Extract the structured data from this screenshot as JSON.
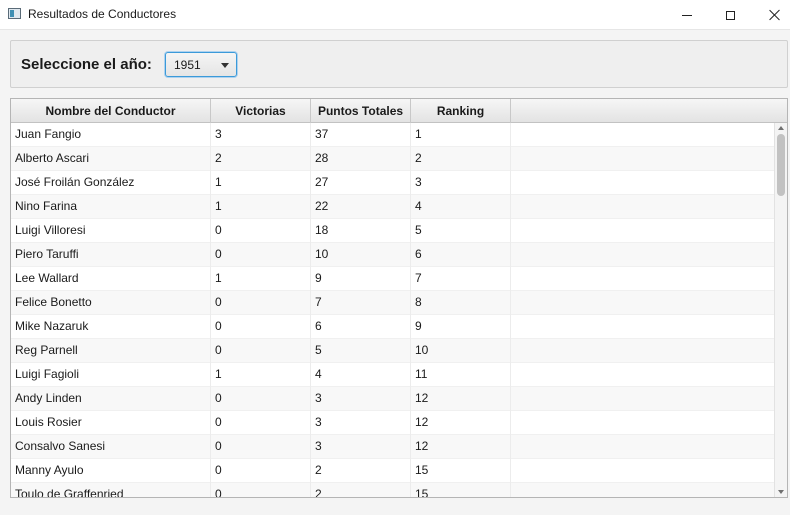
{
  "window": {
    "title": "Resultados de Conductores"
  },
  "selector": {
    "label": "Seleccione el año:",
    "selected_year": "1951"
  },
  "table": {
    "columns": [
      "Nombre del Conductor",
      "Victorias",
      "Puntos Totales",
      "Ranking",
      ""
    ],
    "rows": [
      [
        "Juan Fangio",
        "3",
        "37",
        "1"
      ],
      [
        "Alberto Ascari",
        "2",
        "28",
        "2"
      ],
      [
        "José Froilán González",
        "1",
        "27",
        "3"
      ],
      [
        "Nino Farina",
        "1",
        "22",
        "4"
      ],
      [
        "Luigi Villoresi",
        "0",
        "18",
        "5"
      ],
      [
        "Piero Taruffi",
        "0",
        "10",
        "6"
      ],
      [
        "Lee Wallard",
        "1",
        "9",
        "7"
      ],
      [
        "Felice Bonetto",
        "0",
        "7",
        "8"
      ],
      [
        "Mike Nazaruk",
        "0",
        "6",
        "9"
      ],
      [
        "Reg Parnell",
        "0",
        "5",
        "10"
      ],
      [
        "Luigi Fagioli",
        "1",
        "4",
        "11"
      ],
      [
        "Andy Linden",
        "0",
        "3",
        "12"
      ],
      [
        "Louis Rosier",
        "0",
        "3",
        "12"
      ],
      [
        "Consalvo Sanesi",
        "0",
        "3",
        "12"
      ],
      [
        "Manny Ayulo",
        "0",
        "2",
        "15"
      ],
      [
        "Toulo de Graffenried",
        "0",
        "2",
        "15"
      ]
    ]
  }
}
